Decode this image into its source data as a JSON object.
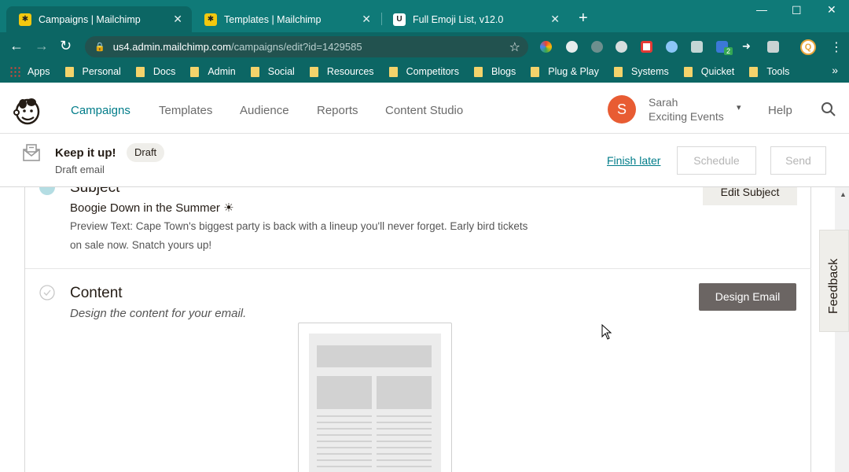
{
  "browser": {
    "tabs": [
      {
        "title": "Campaigns | Mailchimp",
        "favicon": "mailchimp-icon"
      },
      {
        "title": "Templates | Mailchimp",
        "favicon": "mailchimp-icon"
      },
      {
        "title": "Full Emoji List, v12.0",
        "favicon": "unicode-icon"
      }
    ],
    "address": {
      "host": "us4.admin.mailchimp.com",
      "path": "/campaigns/edit?id=1429585"
    },
    "bookmarks": [
      "Apps",
      "Personal",
      "Docs",
      "Admin",
      "Social",
      "Resources",
      "Competitors",
      "Blogs",
      "Plug & Play",
      "Systems",
      "Quicket",
      "Tools"
    ],
    "profile_initial": "Q",
    "extension_badge": "2"
  },
  "header": {
    "nav": [
      "Campaigns",
      "Templates",
      "Audience",
      "Reports",
      "Content Studio"
    ],
    "user": {
      "initial": "S",
      "name": "Sarah",
      "org": "Exciting Events"
    },
    "help": "Help"
  },
  "campaign": {
    "title": "Keep it up!",
    "status": "Draft",
    "type": "Draft email",
    "finish_later": "Finish later",
    "schedule": "Schedule",
    "send": "Send"
  },
  "subject": {
    "heading": "Subject",
    "line": "Boogie Down in the Summer ☀",
    "preview": "Preview Text: Cape Town's biggest party is back with a lineup you'll never forget. Early bird tickets on sale now. Snatch yours up!",
    "edit": "Edit Subject"
  },
  "content": {
    "heading": "Content",
    "sub": "Design the content for your email.",
    "design": "Design Email"
  },
  "feedback": "Feedback",
  "colors": {
    "chrome": "#0f7a78",
    "accent": "#007c89",
    "avatar": "#e85c33",
    "design_btn": "#6b6563"
  }
}
